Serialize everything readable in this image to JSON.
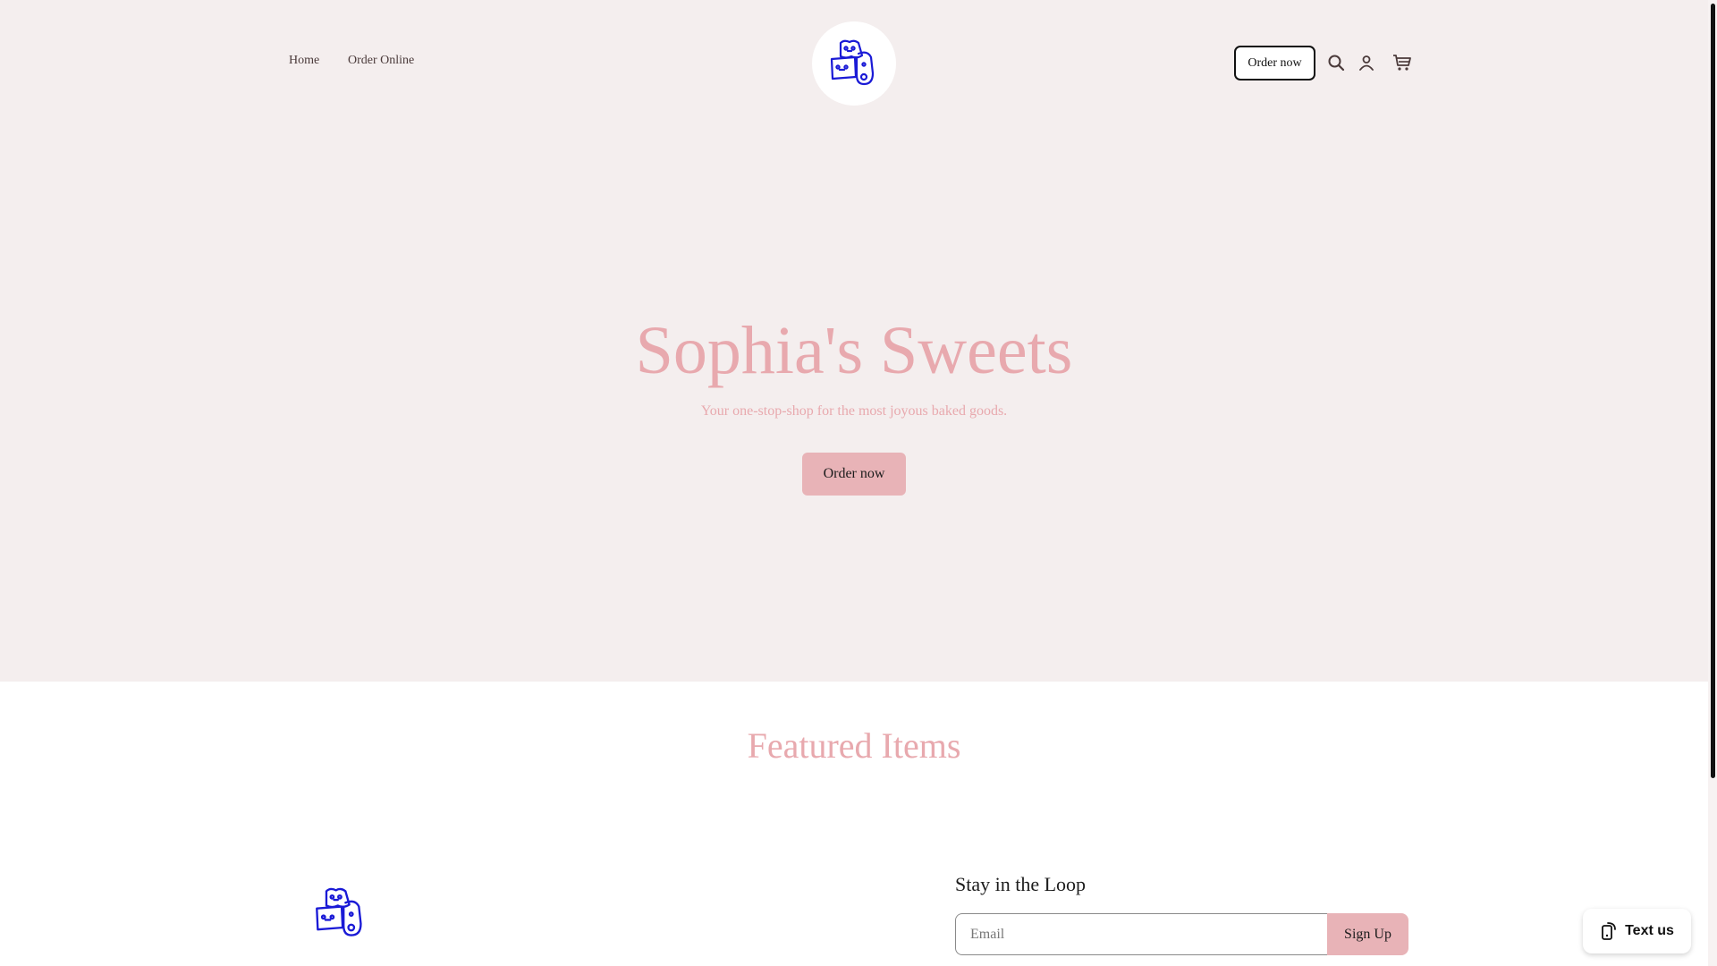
{
  "header": {
    "nav": [
      {
        "label": "Home"
      },
      {
        "label": "Order Online"
      }
    ],
    "logo_icon": "bakery-cookies-logo",
    "order_button_label": "Order now",
    "icons": [
      "search-icon",
      "account-icon",
      "cart-icon"
    ]
  },
  "hero": {
    "title": "Sophia's Sweets",
    "subtitle": "Your one-stop-shop for the most joyous baked goods.",
    "cta_label": "Order now"
  },
  "featured": {
    "title": "Featured Items"
  },
  "footer": {
    "newsletter_title": "Stay in the Loop",
    "email_placeholder": "Email",
    "signup_label": "Sign Up"
  },
  "widget": {
    "text_us_label": "Text us"
  },
  "colors": {
    "hero_background": "#f4eeee",
    "accent_pink": "#e8a9ae",
    "button_pink": "#e8b3b7",
    "logo_blue": "#1a1ad6"
  }
}
